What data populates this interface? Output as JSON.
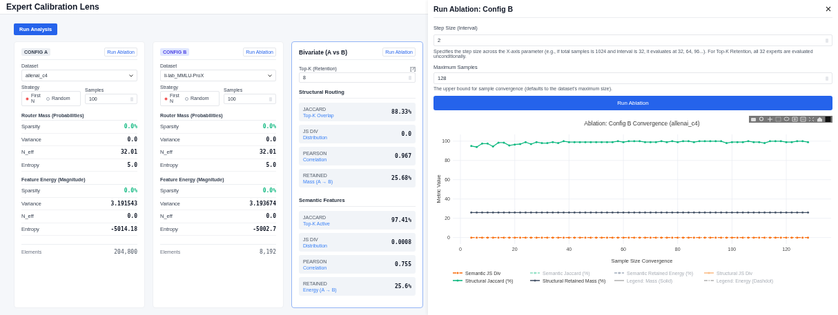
{
  "app": {
    "title": "Expert Calibration Lens",
    "run_button": "Run Analysis"
  },
  "configs": [
    {
      "badge": "CONFIG A",
      "kind": "a",
      "run": "Run Ablation",
      "dataset_label": "Dataset",
      "dataset": "allenai_c4",
      "strategy_label": "Strategy",
      "options": [
        {
          "label": "First N",
          "selected": true
        },
        {
          "label": "Random",
          "selected": false
        }
      ],
      "samples_label": "Samples",
      "samples": "100",
      "router_title": "Router Mass (Probabilities)",
      "router_metrics": [
        {
          "label": "Sparsity",
          "value": "0.0%",
          "highlighted": true
        },
        {
          "label": "Variance",
          "value": "0.0",
          "highlighted": false
        },
        {
          "label": "N_eff",
          "value": "32.01",
          "highlighted": false
        },
        {
          "label": "Entropy",
          "value": "5.0",
          "highlighted": false
        }
      ],
      "energy_title": "Feature Energy (Magnitude)",
      "energy_metrics": [
        {
          "label": "Sparsity",
          "value": "0.0%",
          "highlighted": true
        },
        {
          "label": "Variance",
          "value": "3.191543",
          "highlighted": false
        },
        {
          "label": "N_eff",
          "value": "0.0",
          "highlighted": false
        },
        {
          "label": "Entropy",
          "value": "-5014.18",
          "highlighted": false
        }
      ],
      "elements_label": "Elements",
      "elements": "204,800"
    },
    {
      "badge": "CONFIG B",
      "kind": "b",
      "run": "Run Ablation",
      "dataset_label": "Dataset",
      "dataset": "li-lab_MMLU-ProX",
      "strategy_label": "Strategy",
      "options": [
        {
          "label": "First N",
          "selected": true
        },
        {
          "label": "Random",
          "selected": false
        }
      ],
      "samples_label": "Samples",
      "samples": "100",
      "router_title": "Router Mass (Probabilities)",
      "router_metrics": [
        {
          "label": "Sparsity",
          "value": "0.0%",
          "highlighted": true
        },
        {
          "label": "Variance",
          "value": "0.0",
          "highlighted": false
        },
        {
          "label": "N_eff",
          "value": "32.01",
          "highlighted": false
        },
        {
          "label": "Entropy",
          "value": "5.0",
          "highlighted": false
        }
      ],
      "energy_title": "Feature Energy (Magnitude)",
      "energy_metrics": [
        {
          "label": "Sparsity",
          "value": "0.0%",
          "highlighted": true
        },
        {
          "label": "Variance",
          "value": "3.193674",
          "highlighted": false
        },
        {
          "label": "N_eff",
          "value": "0.0",
          "highlighted": false
        },
        {
          "label": "Entropy",
          "value": "-5002.7",
          "highlighted": false
        }
      ],
      "elements_label": "Elements",
      "elements": "8,192"
    }
  ],
  "bivariate": {
    "title": "Bivariate (A vs B)",
    "run": "Run Ablation",
    "topk_label": "Top-K (Retention)",
    "help": "[?]",
    "topk": "8",
    "sections": [
      {
        "title": "Structural Routing",
        "metrics": [
          {
            "name": "JACCARD",
            "sub": "Top-K Overlap",
            "value": "88.33%"
          },
          {
            "name": "JS DIV",
            "sub": "Distribution",
            "value": "0.0"
          },
          {
            "name": "PEARSON",
            "sub": "Correlation",
            "value": "0.967"
          },
          {
            "name": "RETAINED",
            "sub": "Mass (A → B)",
            "value": "25.68%"
          }
        ]
      },
      {
        "title": "Semantic Features",
        "metrics": [
          {
            "name": "JACCARD",
            "sub": "Top-K Active",
            "value": "97.41%"
          },
          {
            "name": "JS DIV",
            "sub": "Distribution",
            "value": "0.0008"
          },
          {
            "name": "PEARSON",
            "sub": "Correlation",
            "value": "0.755"
          },
          {
            "name": "RETAINED",
            "sub": "Energy (A → B)",
            "value": "25.6%"
          }
        ]
      }
    ]
  },
  "ablation": {
    "title": "Run Ablation: Config B",
    "step_label": "Step Size (Interval)",
    "step_value": "2",
    "step_help": "Specifies the step size across the X-axis parameter (e.g., if total samples is 1024 and interval is 32, it evaluates at 32, 64, 96...). For Top-K Retention, all 32 experts are evaluated unconditionally.",
    "max_label": "Maximum Samples",
    "max_value": "128",
    "max_help": "The upper bound for sample convergence (defaults to the dataset's maximum size).",
    "run": "Run Ablation",
    "chart": {
      "chart_data": {
        "type": "line",
        "title": "Ablation: Config B Convergence (allenai_c4)",
        "xlabel": "Sample Size Convergence",
        "ylabel": "Metric Value",
        "xlim": [
          -2.8,
          136.5
        ],
        "ylim": [
          -6.7,
          107
        ],
        "xticks": [
          0,
          20,
          40,
          60,
          80,
          100,
          120
        ],
        "yticks": [
          0,
          20,
          40,
          60,
          80,
          100
        ],
        "grid": true,
        "legend": true,
        "x": [
          4,
          6,
          8,
          10,
          12,
          14,
          16,
          18,
          20,
          22,
          24,
          26,
          28,
          30,
          32,
          34,
          36,
          38,
          40,
          42,
          44,
          46,
          48,
          50,
          52,
          54,
          56,
          58,
          60,
          62,
          64,
          66,
          68,
          70,
          72,
          74,
          76,
          78,
          80,
          82,
          84,
          86,
          88,
          90,
          92,
          94,
          96,
          98,
          100,
          102,
          104,
          106,
          108,
          110,
          112,
          114,
          116,
          118,
          120,
          122,
          124,
          126,
          128
        ],
        "series": [
          {
            "name": "Semantic JS Div",
            "color": "#f97316",
            "line_style": "dashdot",
            "values": [
              0,
              0,
              0,
              0,
              0,
              0,
              0,
              0,
              0,
              0,
              0,
              0,
              0,
              0,
              0,
              0,
              0,
              0,
              0,
              0,
              0,
              0,
              0,
              0,
              0,
              0,
              0,
              0,
              0,
              0,
              0,
              0,
              0,
              0,
              0,
              0,
              0,
              0,
              0,
              0,
              0,
              0,
              0,
              0,
              0,
              0,
              0,
              0,
              0,
              0,
              0,
              0,
              0,
              0,
              0,
              0,
              0,
              0,
              0,
              0,
              0,
              0,
              0
            ]
          },
          {
            "name": "Structural Jaccard (%)",
            "color": "#10b981",
            "line_style": "solid",
            "values": [
              95,
              94,
              97.5,
              97.5,
              94.5,
              98.5,
              98.5,
              95.5,
              96.5,
              97,
              99,
              97,
              99,
              98,
              98,
              99,
              98,
              100,
              99,
              99,
              99,
              99,
              99,
              99,
              99,
              99,
              99,
              100,
              99,
              100,
              100,
              100,
              99,
              99,
              99,
              100,
              99,
              100,
              99,
              100,
              100,
              99,
              100,
              100,
              100,
              100,
              100,
              98,
              99,
              99,
              99,
              100,
              99,
              99,
              98,
              100,
              100,
              100,
              99,
              99,
              100,
              100,
              99
            ]
          },
          {
            "name": "Structural Retained Mass (%)",
            "color": "#475569",
            "line_style": "solid",
            "values": [
              26,
              26,
              26,
              26,
              26,
              26,
              26,
              26,
              26,
              26,
              26,
              26,
              26,
              26,
              26,
              26,
              26,
              26,
              26,
              26,
              26,
              26,
              26,
              26,
              26,
              26,
              26,
              26,
              26,
              26,
              26,
              26,
              26,
              26,
              26,
              26,
              26,
              26,
              26,
              26,
              26,
              26,
              26,
              26,
              26,
              26,
              26,
              26,
              26,
              26,
              26,
              26,
              26,
              26,
              26,
              26,
              26,
              26,
              26,
              26,
              26,
              26,
              26
            ]
          }
        ]
      },
      "legend": [
        {
          "kind": "series",
          "hidden": false
        },
        {
          "kind": "extra",
          "label": "Semantic Jaccard (%)",
          "color": "#8fe0c4",
          "dashed": true,
          "dotted": false,
          "marker": true,
          "hidden": true
        },
        {
          "kind": "extra",
          "label": "Semantic Retained Energy (%)",
          "color": "#a9b2c0",
          "dashed": true,
          "dotted": false,
          "marker": true,
          "hidden": true
        },
        {
          "kind": "extra",
          "label": "Structural JS Div",
          "color": "#fbbf8a",
          "dashed": false,
          "dotted": false,
          "marker": true,
          "hidden": true
        },
        {
          "kind": "series",
          "hidden": false
        },
        {
          "kind": "series",
          "hidden": false
        },
        {
          "kind": "extra",
          "label": "Legend: Mass (Solid)",
          "color": "#b5b5b5",
          "dashed": false,
          "dotted": false,
          "marker": false,
          "hidden": true
        },
        {
          "kind": "extra",
          "label": "Legend: Energy (Dashdot)",
          "color": "#b5b5b5",
          "dashed": true,
          "dotted": true,
          "marker": false,
          "hidden": true
        }
      ]
    }
  }
}
